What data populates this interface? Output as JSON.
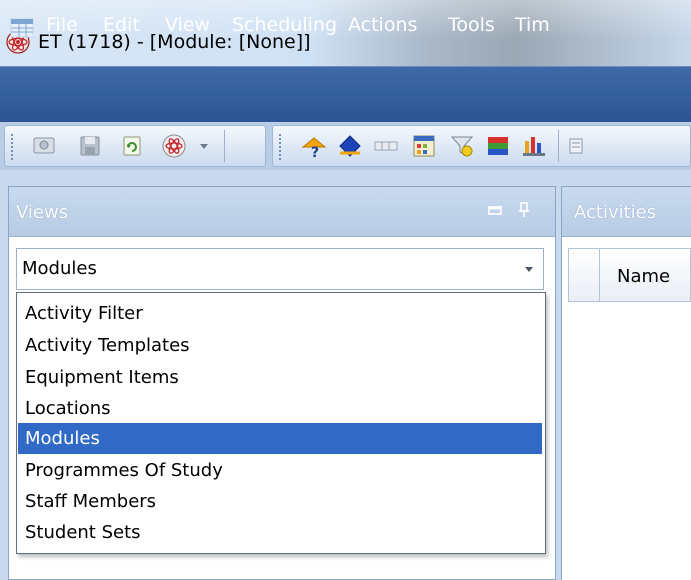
{
  "window": {
    "title": "ET (1718) - [Module: [None]]",
    "app_icon": "atom-logo-icon"
  },
  "menu": {
    "app_icon": "grid-menu-icon",
    "items": [
      "File",
      "Edit",
      "View",
      "Scheduling",
      "Actions",
      "Tools",
      "Tim"
    ]
  },
  "toolbar": {
    "icons": [
      "screen-icon",
      "save-icon",
      "refresh-icon",
      "atom-icon",
      "dropdown-arrow-icon",
      "help-cursor-icon",
      "navigate-icon",
      "timeline-icon",
      "calendar-icon",
      "filter-icon",
      "color-bars-icon",
      "bar-chart-icon",
      "more-icon"
    ]
  },
  "views_panel": {
    "title": "Views",
    "combo_value": "Modules",
    "options": [
      "Activity Filter",
      "Activity Templates",
      "Equipment Items",
      "Locations",
      "Modules",
      "Programmes Of Study",
      "Staff Members",
      "Student Sets"
    ],
    "selected_index": 4
  },
  "activities_panel": {
    "title": "Activities",
    "columns": [
      "Name"
    ]
  },
  "colors": {
    "menubar": "#34609e",
    "selection": "#3169c6",
    "panel_header": "#b7cbe5"
  }
}
